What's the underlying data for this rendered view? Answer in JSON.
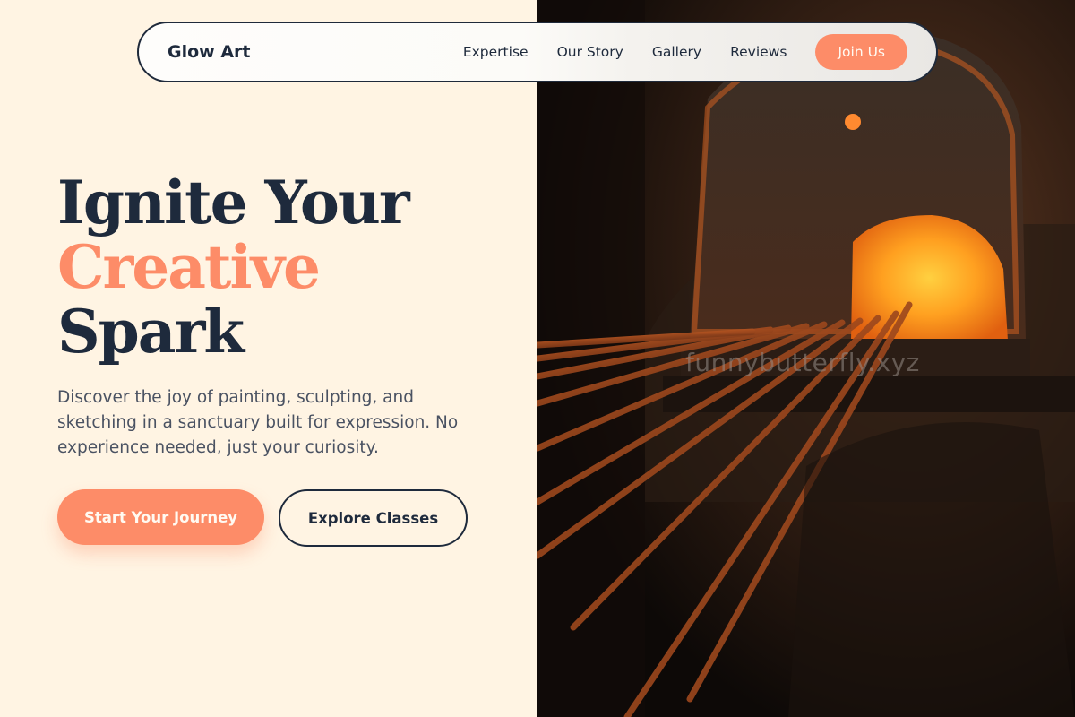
{
  "nav": {
    "brand": "Glow Art",
    "links": [
      "Expertise",
      "Our Story",
      "Gallery",
      "Reviews"
    ],
    "cta": "Join Us"
  },
  "hero": {
    "headline": [
      "Ignite Your",
      "Creative",
      "Spark"
    ],
    "subtext": "Discover the joy of painting, sculpting, and sketching in a sanctuary built for expression. No experience needed, just your curiosity.",
    "primary_cta": "Start Your Journey",
    "secondary_cta": "Explore Classes"
  },
  "image": {
    "watermark": "funnybutterfly.xyz"
  },
  "colors": {
    "accent": "#fd8c68",
    "navy": "#1e2a3c",
    "cream": "#fff4e3"
  }
}
